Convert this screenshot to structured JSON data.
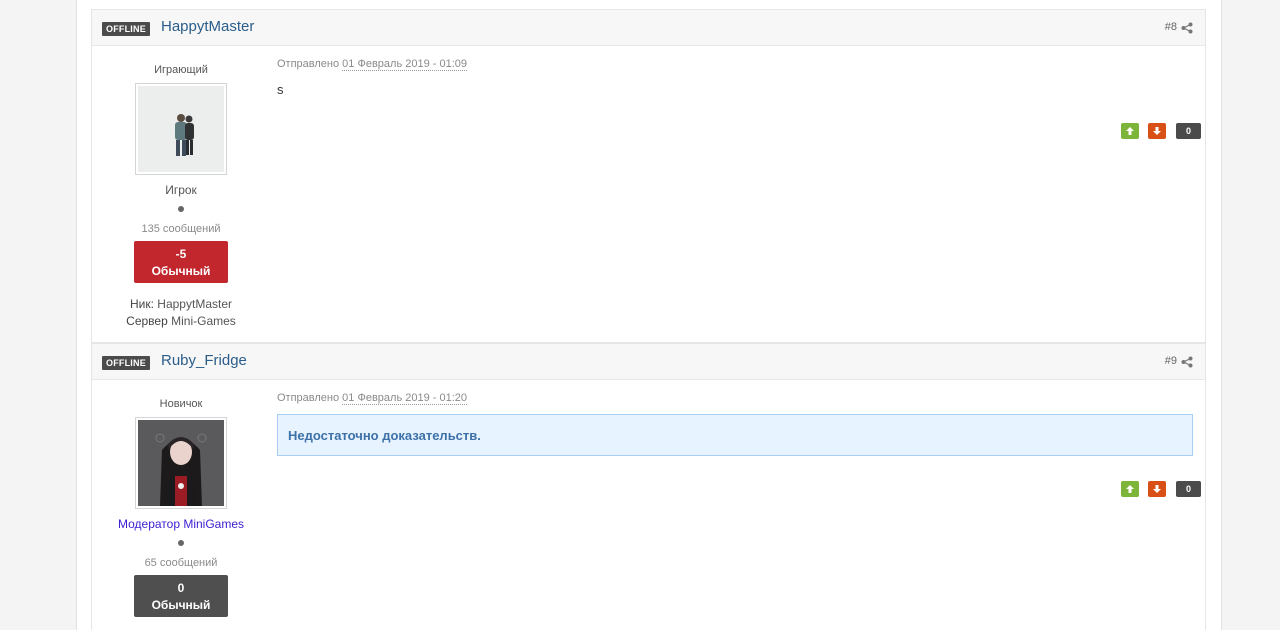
{
  "posts": [
    {
      "status": "OFFLINE",
      "author": "HappytMaster",
      "post_number": "#8",
      "group_title": "Играющий",
      "rank": "Игрок",
      "post_count": "135 сообщений",
      "reputation_value": "-5",
      "reputation_label": "Обычный",
      "fields": [
        {
          "label": "Ник:",
          "value": "HappytMaster"
        },
        {
          "label": "Сервер",
          "value": "Mini-Games"
        }
      ],
      "posted_label": "Отправлено",
      "posted_date": "01 Февраль 2019 - 01:09",
      "content": "s",
      "rep_count": "0",
      "colors": {
        "reputation_bg": "#c1272d"
      }
    },
    {
      "status": "OFFLINE",
      "author": "Ruby_Fridge",
      "post_number": "#9",
      "group_title": "Новичок",
      "rank": "Модератор MiniGames",
      "post_count": "65 сообщений",
      "reputation_value": "0",
      "reputation_label": "Обычный",
      "posted_label": "Отправлено",
      "posted_date": "01 Февраль 2019 - 01:20",
      "content": "Недостаточно доказательств.",
      "rep_count": "0",
      "colors": {
        "reputation_bg": "#4f4f4f",
        "rank_color": "#3a1fd1"
      }
    }
  ],
  "icons": {
    "share": "share-icon",
    "rep_up": "arrow-up-icon",
    "rep_down": "arrow-down-icon"
  }
}
